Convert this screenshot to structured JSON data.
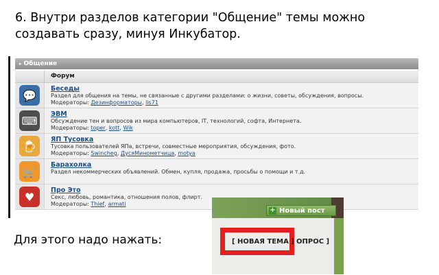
{
  "heading": {
    "line1": "6. Внутри разделов категории \"Общение\" темы можно",
    "line2": "создавать сразу, минуя Инкубатор."
  },
  "forum": {
    "category_title": "Общение",
    "column_header": "Форум",
    "rows": [
      {
        "name": "Беседы",
        "icon": "chat-bubbles-icon",
        "color": "#3a6ea5",
        "description": "Раздел для общения на темы, не связанные с другими разделами: о жизни, советы, обсуждения, вопросы.",
        "mods_label": "Модераторы:",
        "mods": [
          "Дезинформаторы",
          "lis71"
        ]
      },
      {
        "name": "ЭВМ",
        "icon": "keyboard-icon",
        "color": "#4d4d4d",
        "description": "Обсуждение тен и вопросов из мира компьютеров, IT, технологий, софта, Интернета.",
        "mods_label": "Модераторы:",
        "mods": [
          "toper",
          "kott",
          "Wik"
        ]
      },
      {
        "name": "ЯП Тусовка",
        "icon": "beer-mug-icon",
        "color": "#e8a83a",
        "description": "Тусовка пользователей ЯПа, встречи, совместные мероприятия, обсуждения, фото.",
        "mods_label": "Модераторы:",
        "mods": [
          "Swincheg",
          "ДусяМинометчица",
          "motya"
        ]
      },
      {
        "name": "Барахолка",
        "icon": "shopping-cart-icon",
        "color": "#f0962a",
        "description": "Раздел некоммерческих объявлений. Обмен, купля, продажа, просьбы о помощи и т.д.",
        "mods_label": "",
        "mods": []
      },
      {
        "name": "Про Это",
        "icon": "heart-icon",
        "color": "#c8302a",
        "description": "Секс, любовь, романтика, отношения полов, флирт.",
        "mods_label": "Модераторы:",
        "mods": [
          "Thief",
          "armati"
        ]
      }
    ]
  },
  "inset": {
    "new_post": "Новый пост",
    "new_topic": "[ НОВАЯ ТЕМА ]",
    "poll": "ОПРОС ]",
    "highlight_color": "#e51f1f"
  },
  "instruction": "Для этого надо нажать:"
}
